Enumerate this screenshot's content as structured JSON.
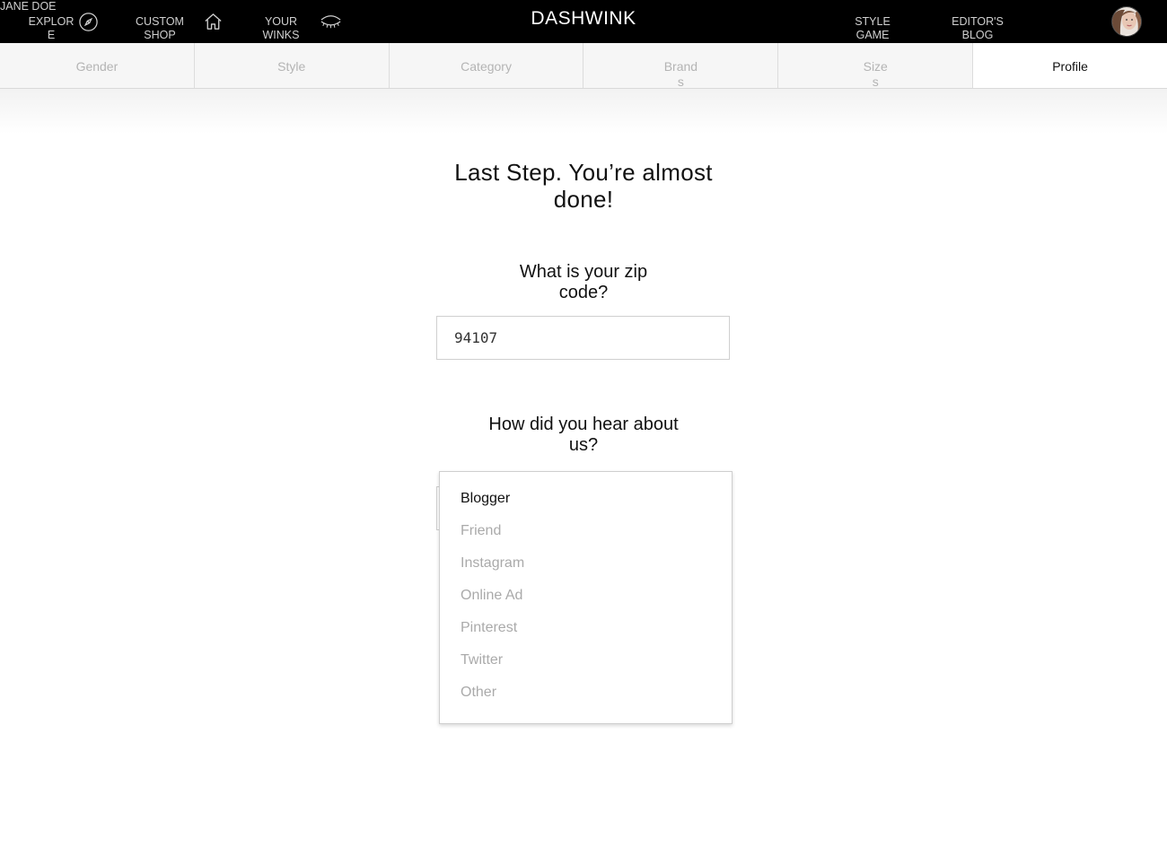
{
  "header": {
    "logo": "DASHWINK",
    "nav": {
      "explore_line1": "EXPLOR",
      "explore_line2": "E",
      "custom_line1": "CUSTOM",
      "custom_line2": "SHOP",
      "winks_line1": "YOUR",
      "winks_line2": "WINKS",
      "style_line1": "STYLE",
      "style_line2": "GAME",
      "editor_line1": "EDITOR'S",
      "editor_line2": "BLOG"
    },
    "user_name": "JANE DOE",
    "icons": [
      "compass-icon",
      "home-icon",
      "eye-icon"
    ]
  },
  "tabs": {
    "gender": "Gender",
    "style": "Style",
    "category": "Category",
    "brands_line1": "Brand",
    "brands_line2": "s",
    "sizes_line1": "Size",
    "sizes_line2": "s",
    "profile": "Profile",
    "active": "Profile"
  },
  "main": {
    "headline_line1": "Last Step. You’re almost",
    "headline_line2": "done!",
    "zip_question_line1": "What is your zip",
    "zip_question_line2": "code?",
    "zip_value": "94107",
    "hear_question_line1": "How did you hear about",
    "hear_question_line2": "us?",
    "hear_options": [
      "Blogger",
      "Friend",
      "Instagram",
      "Online Ad",
      "Pinterest",
      "Twitter",
      "Other"
    ],
    "hear_highlighted": "Blogger"
  },
  "colors": {
    "topbar": "#000000",
    "tab_inactive_bg": "#f6f6f6",
    "tab_inactive_text": "#b4b4b4",
    "option_text": "#aaaaaa"
  }
}
